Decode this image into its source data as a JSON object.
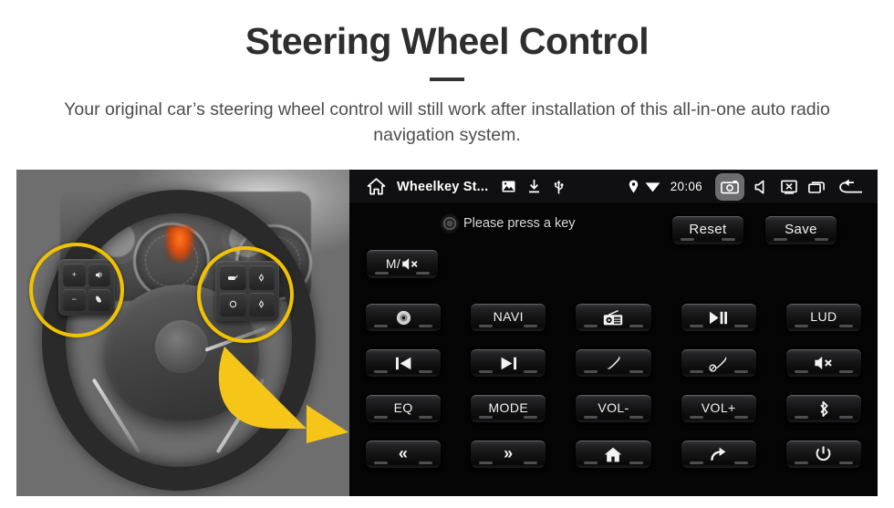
{
  "header": {
    "title": "Steering Wheel Control",
    "subtitle": "Your original car’s steering wheel control will still work after installation of this all-in-one auto radio navigation system."
  },
  "colors": {
    "page_background": "#ffffff",
    "title_text": "#2e2e2e",
    "subtitle_text": "#4d4d4d",
    "highlight_yellow": "#f2c200",
    "arrow_yellow": "#f5c518",
    "unit_background": "#050506",
    "statusbar_background": "#101012",
    "button_text": "#f2f2f2",
    "screenshot_icon_highlight": "#6d6d70"
  },
  "photo": {
    "name": "steering-wheel-photo",
    "description": "Grayscale photo of a car steering wheel with two yellow circles highlighting the left and right steering wheel control pads, and a yellow curved arrow pointing right toward the radio screen",
    "highlights": [
      {
        "label": "left-control-pad-highlight"
      },
      {
        "label": "right-control-pad-highlight"
      }
    ],
    "left_pad_keys": [
      "+",
      "voice-icon",
      "−",
      "phone-icon"
    ],
    "right_pad_keys": [
      "source-icon",
      "up-icon",
      "circle-icon",
      "down-icon"
    ],
    "arrow": "curved-arrow-right"
  },
  "statusbar": {
    "home_icon": "home-icon",
    "app_title": "Wheelkey St...",
    "left_icons": [
      "image-icon",
      "download-icon",
      "usb-icon"
    ],
    "location_icon": "location-pin-icon",
    "wifi_icon": "wifi-icon",
    "clock": "20:06",
    "right_icons": [
      {
        "name": "screenshot-icon",
        "active": true
      },
      {
        "name": "volume-icon",
        "active": false
      },
      {
        "name": "screen-off-icon",
        "active": false
      },
      {
        "name": "recent-apps-icon",
        "active": false
      },
      {
        "name": "back-icon",
        "active": false
      }
    ]
  },
  "panel": {
    "prompt_indicator": "key-indicator-icon",
    "prompt_text": "Please press a key",
    "reset_label": "Reset",
    "save_label": "Save",
    "mute_label": "M/",
    "mute_icon": "mute-speaker-icon"
  },
  "key_grid": {
    "columns": 5,
    "rows": 4,
    "buttons": [
      {
        "name": "disc-key",
        "label": "",
        "icon": "disc-icon"
      },
      {
        "name": "navi-key",
        "label": "NAVI",
        "icon": ""
      },
      {
        "name": "radio-key",
        "label": "",
        "icon": "radio-icon"
      },
      {
        "name": "play-pause-key",
        "label": "",
        "icon": "play-pause-icon"
      },
      {
        "name": "lud-key",
        "label": "LUD",
        "icon": ""
      },
      {
        "name": "previous-key",
        "label": "",
        "icon": "previous-track-icon"
      },
      {
        "name": "next-key",
        "label": "",
        "icon": "next-track-icon"
      },
      {
        "name": "call-answer-key",
        "label": "",
        "icon": "phone-icon"
      },
      {
        "name": "call-end-key",
        "label": "",
        "icon": "phone-hangup-icon"
      },
      {
        "name": "mute-key",
        "label": "",
        "icon": "mute-speaker-icon"
      },
      {
        "name": "eq-key",
        "label": "EQ",
        "icon": ""
      },
      {
        "name": "mode-key",
        "label": "MODE",
        "icon": ""
      },
      {
        "name": "volume-down-key",
        "label": "VOL-",
        "icon": ""
      },
      {
        "name": "volume-up-key",
        "label": "VOL+",
        "icon": ""
      },
      {
        "name": "bluetooth-key",
        "label": "",
        "icon": "bluetooth-icon"
      },
      {
        "name": "seek-back-key",
        "label": "«",
        "icon": ""
      },
      {
        "name": "seek-forward-key",
        "label": "»",
        "icon": ""
      },
      {
        "name": "home-key",
        "label": "",
        "icon": "home-icon"
      },
      {
        "name": "return-key",
        "label": "",
        "icon": "return-arrow-icon"
      },
      {
        "name": "power-key",
        "label": "",
        "icon": "power-icon"
      }
    ]
  }
}
